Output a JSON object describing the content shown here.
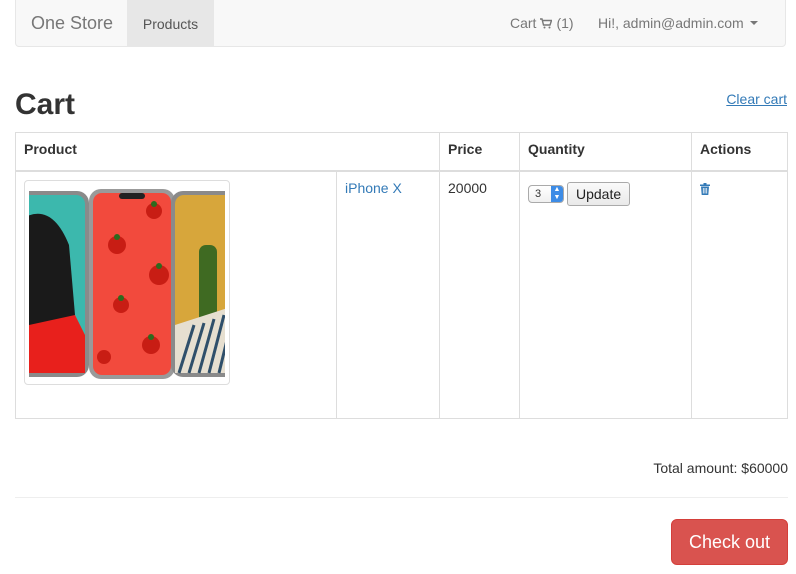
{
  "navbar": {
    "brand": "One Store",
    "products_label": "Products",
    "cart_label": "Cart",
    "cart_count": "(1)",
    "user_label": "Hi!, admin@admin.com"
  },
  "page": {
    "title": "Cart",
    "clear_cart_label": "Clear cart"
  },
  "table": {
    "headers": [
      "Product",
      "Price",
      "Quantity",
      "Actions"
    ],
    "rows": [
      {
        "product_name": "iPhone X",
        "price": "20000",
        "quantity": "3",
        "update_label": "Update"
      }
    ]
  },
  "summary": {
    "total_text": "Total amount: $60000",
    "checkout_label": "Check out"
  },
  "colors": {
    "link": "#337ab7",
    "danger": "#d9534f",
    "navbar_bg": "#f8f8f8"
  },
  "icons": {
    "cart": "shopping-cart-icon",
    "trash": "trash-icon",
    "caret": "caret-down-icon"
  }
}
